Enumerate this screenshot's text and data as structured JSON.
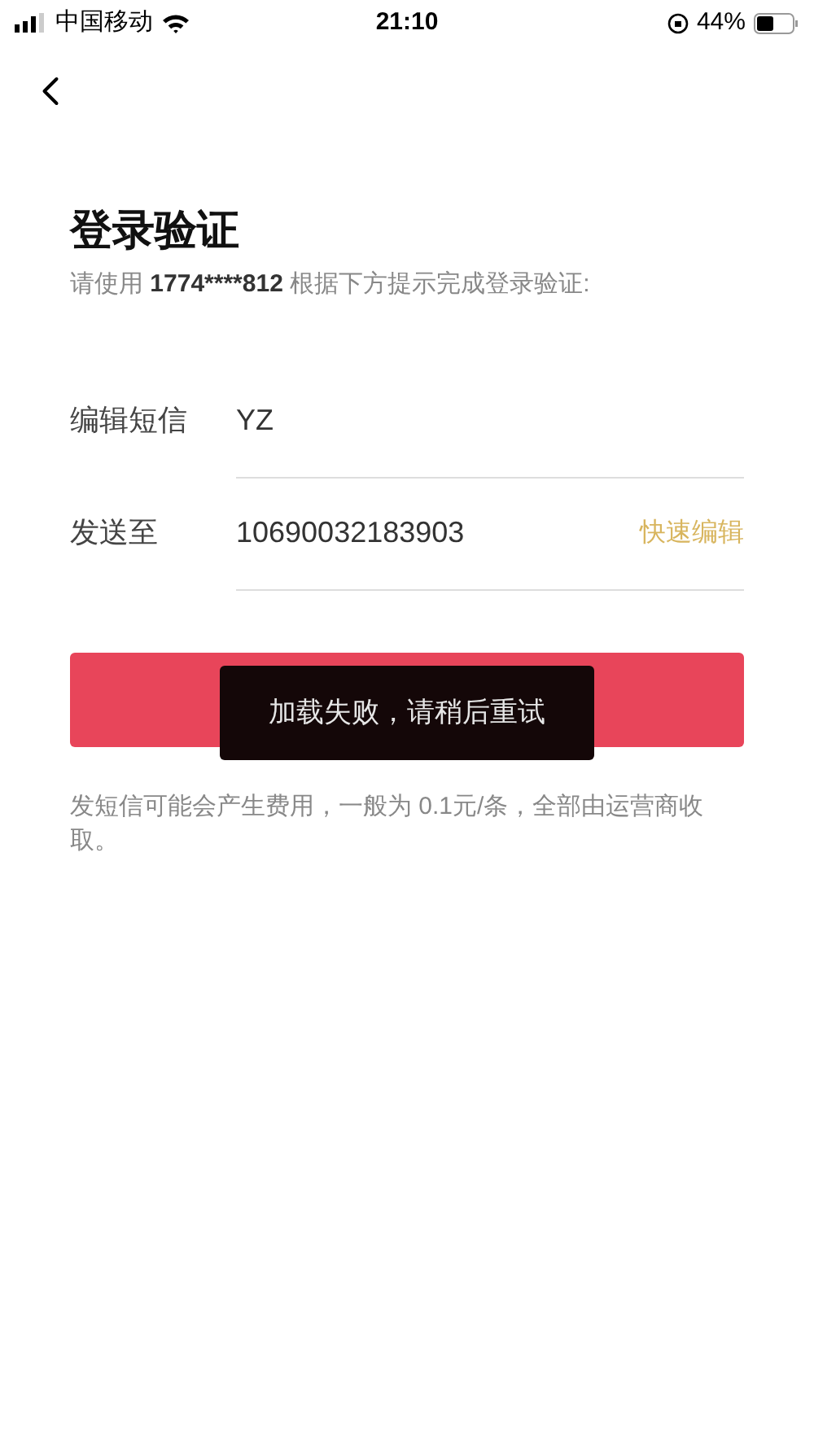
{
  "status_bar": {
    "carrier": "中国移动",
    "time": "21:10",
    "battery": "44%"
  },
  "title": "登录验证",
  "subtitle": {
    "prefix": "请使用 ",
    "phone": "1774****812",
    "suffix": " 根据下方提示完成登录验证:"
  },
  "fields": [
    {
      "label": "编辑短信",
      "value": "YZ"
    },
    {
      "label": "发送至",
      "value": "10690032183903",
      "action": "快速编辑"
    }
  ],
  "toast": "加载失败，请稍后重试",
  "note": "发短信可能会产生费用，一般为 0.1元/条，全部由运营商收取。"
}
